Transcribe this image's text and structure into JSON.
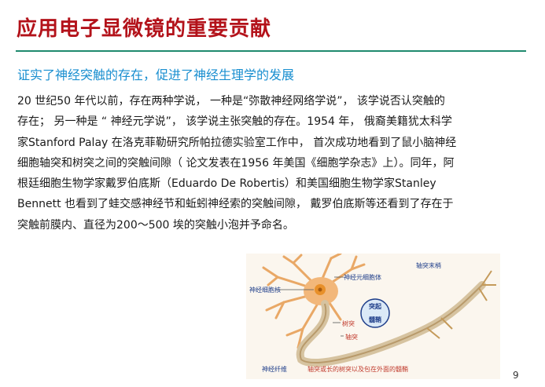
{
  "slide": {
    "title": "应用电子显微镜的重要贡献",
    "subtitle": "证实了神经突触的存在，促进了神经生理学的发展",
    "body_lines": [
      "20 世纪50 年代以前，存在两种学说，  一种是“弥散神经网络学说”，  该学说否认突触的",
      "存在；  另一种是 “ 神经元学说”，  该学说主张突触的存在。1954 年，  俄裔美籍犹太科学",
      "家Stanford Palay 在洛克菲勒研究所帕拉德实验室工作中，  首次成功地看到了鼠小脑神经",
      "细胞轴突和树突之间的突触间隙（ 论文发表在1956 年美国《细胞学杂志》上）。同年，阿",
      "根廷细胞生物学家戴罗伯底斯（Eduardo De Robertis）和美国细胞生物学家Stanley",
      "Bennett 也看到了蛙交感神经节和蚯蚓神经索的突触间隙，  戴罗伯底斯等还看到了存在于",
      "突触前膜内、直径为200～500 埃的突触小泡并予命名。"
    ],
    "page_number": "9"
  },
  "figure": {
    "labels": {
      "cell_body": "神经元细胞体",
      "nucleus": "神经细胞核",
      "axon_terminal": "轴突末梢",
      "synapse": "突起",
      "myelin": "髓鞘",
      "dendrite": "树突",
      "axon": "轴突",
      "nerve_fiber": "神经纤维",
      "caption": "轴突或长的树突以及包在外面的髓鞘"
    },
    "colors": {
      "neuron": "#f2b77a",
      "nucleus": "#e8902a",
      "axon": "#d6c3a0",
      "background": "#fbf6ee"
    }
  }
}
